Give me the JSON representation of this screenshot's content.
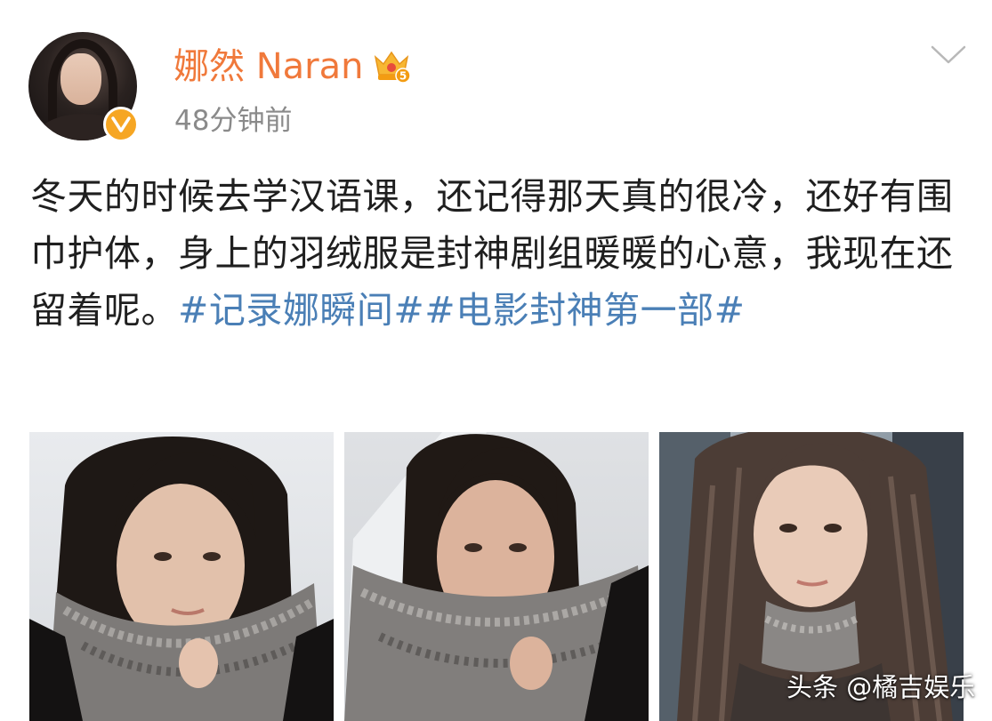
{
  "post": {
    "author": {
      "name": "娜然 Naran",
      "avatar_icon": "avatar-photo",
      "verified_icon": "verified-v-badge",
      "level_icon": "crown-level-badge",
      "level_text": "5"
    },
    "timestamp": "48分钟前",
    "menu_icon": "chevron-down-icon",
    "text_segments": [
      {
        "text": "冬天的时候去学汉语课，还记得那天真的很冷，还好有围巾护体，身上的羽绒服是封神剧组暖暖的心意，我现在还留着呢。",
        "type": "plain"
      },
      {
        "text": "#记录娜瞬间#",
        "type": "hashtag"
      },
      {
        "text": "#电影封神第一部#",
        "type": "hashtag"
      }
    ],
    "images": [
      {
        "icon": "selfie-photo-1"
      },
      {
        "icon": "selfie-photo-2"
      },
      {
        "icon": "selfie-photo-3"
      }
    ]
  },
  "watermark": "头条 @橘吉娱乐",
  "colors": {
    "username": "#f0793b",
    "hashtag": "#4a7fb6",
    "timestamp": "#8a8a8a",
    "verified": "#f6a623"
  }
}
